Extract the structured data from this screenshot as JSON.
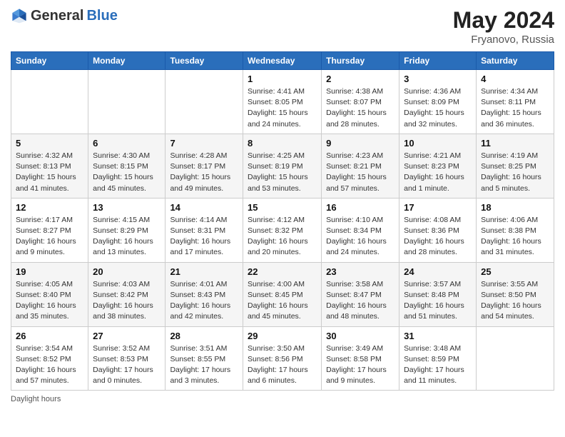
{
  "header": {
    "logo_general": "General",
    "logo_blue": "Blue",
    "title": "May 2024",
    "location": "Fryanovo, Russia"
  },
  "days_of_week": [
    "Sunday",
    "Monday",
    "Tuesday",
    "Wednesday",
    "Thursday",
    "Friday",
    "Saturday"
  ],
  "weeks": [
    [
      {
        "day": "",
        "detail": ""
      },
      {
        "day": "",
        "detail": ""
      },
      {
        "day": "",
        "detail": ""
      },
      {
        "day": "1",
        "detail": "Sunrise: 4:41 AM\nSunset: 8:05 PM\nDaylight: 15 hours\nand 24 minutes."
      },
      {
        "day": "2",
        "detail": "Sunrise: 4:38 AM\nSunset: 8:07 PM\nDaylight: 15 hours\nand 28 minutes."
      },
      {
        "day": "3",
        "detail": "Sunrise: 4:36 AM\nSunset: 8:09 PM\nDaylight: 15 hours\nand 32 minutes."
      },
      {
        "day": "4",
        "detail": "Sunrise: 4:34 AM\nSunset: 8:11 PM\nDaylight: 15 hours\nand 36 minutes."
      }
    ],
    [
      {
        "day": "5",
        "detail": "Sunrise: 4:32 AM\nSunset: 8:13 PM\nDaylight: 15 hours\nand 41 minutes."
      },
      {
        "day": "6",
        "detail": "Sunrise: 4:30 AM\nSunset: 8:15 PM\nDaylight: 15 hours\nand 45 minutes."
      },
      {
        "day": "7",
        "detail": "Sunrise: 4:28 AM\nSunset: 8:17 PM\nDaylight: 15 hours\nand 49 minutes."
      },
      {
        "day": "8",
        "detail": "Sunrise: 4:25 AM\nSunset: 8:19 PM\nDaylight: 15 hours\nand 53 minutes."
      },
      {
        "day": "9",
        "detail": "Sunrise: 4:23 AM\nSunset: 8:21 PM\nDaylight: 15 hours\nand 57 minutes."
      },
      {
        "day": "10",
        "detail": "Sunrise: 4:21 AM\nSunset: 8:23 PM\nDaylight: 16 hours\nand 1 minute."
      },
      {
        "day": "11",
        "detail": "Sunrise: 4:19 AM\nSunset: 8:25 PM\nDaylight: 16 hours\nand 5 minutes."
      }
    ],
    [
      {
        "day": "12",
        "detail": "Sunrise: 4:17 AM\nSunset: 8:27 PM\nDaylight: 16 hours\nand 9 minutes."
      },
      {
        "day": "13",
        "detail": "Sunrise: 4:15 AM\nSunset: 8:29 PM\nDaylight: 16 hours\nand 13 minutes."
      },
      {
        "day": "14",
        "detail": "Sunrise: 4:14 AM\nSunset: 8:31 PM\nDaylight: 16 hours\nand 17 minutes."
      },
      {
        "day": "15",
        "detail": "Sunrise: 4:12 AM\nSunset: 8:32 PM\nDaylight: 16 hours\nand 20 minutes."
      },
      {
        "day": "16",
        "detail": "Sunrise: 4:10 AM\nSunset: 8:34 PM\nDaylight: 16 hours\nand 24 minutes."
      },
      {
        "day": "17",
        "detail": "Sunrise: 4:08 AM\nSunset: 8:36 PM\nDaylight: 16 hours\nand 28 minutes."
      },
      {
        "day": "18",
        "detail": "Sunrise: 4:06 AM\nSunset: 8:38 PM\nDaylight: 16 hours\nand 31 minutes."
      }
    ],
    [
      {
        "day": "19",
        "detail": "Sunrise: 4:05 AM\nSunset: 8:40 PM\nDaylight: 16 hours\nand 35 minutes."
      },
      {
        "day": "20",
        "detail": "Sunrise: 4:03 AM\nSunset: 8:42 PM\nDaylight: 16 hours\nand 38 minutes."
      },
      {
        "day": "21",
        "detail": "Sunrise: 4:01 AM\nSunset: 8:43 PM\nDaylight: 16 hours\nand 42 minutes."
      },
      {
        "day": "22",
        "detail": "Sunrise: 4:00 AM\nSunset: 8:45 PM\nDaylight: 16 hours\nand 45 minutes."
      },
      {
        "day": "23",
        "detail": "Sunrise: 3:58 AM\nSunset: 8:47 PM\nDaylight: 16 hours\nand 48 minutes."
      },
      {
        "day": "24",
        "detail": "Sunrise: 3:57 AM\nSunset: 8:48 PM\nDaylight: 16 hours\nand 51 minutes."
      },
      {
        "day": "25",
        "detail": "Sunrise: 3:55 AM\nSunset: 8:50 PM\nDaylight: 16 hours\nand 54 minutes."
      }
    ],
    [
      {
        "day": "26",
        "detail": "Sunrise: 3:54 AM\nSunset: 8:52 PM\nDaylight: 16 hours\nand 57 minutes."
      },
      {
        "day": "27",
        "detail": "Sunrise: 3:52 AM\nSunset: 8:53 PM\nDaylight: 17 hours\nand 0 minutes."
      },
      {
        "day": "28",
        "detail": "Sunrise: 3:51 AM\nSunset: 8:55 PM\nDaylight: 17 hours\nand 3 minutes."
      },
      {
        "day": "29",
        "detail": "Sunrise: 3:50 AM\nSunset: 8:56 PM\nDaylight: 17 hours\nand 6 minutes."
      },
      {
        "day": "30",
        "detail": "Sunrise: 3:49 AM\nSunset: 8:58 PM\nDaylight: 17 hours\nand 9 minutes."
      },
      {
        "day": "31",
        "detail": "Sunrise: 3:48 AM\nSunset: 8:59 PM\nDaylight: 17 hours\nand 11 minutes."
      },
      {
        "day": "",
        "detail": ""
      }
    ]
  ],
  "footer": {
    "daylight_label": "Daylight hours"
  }
}
